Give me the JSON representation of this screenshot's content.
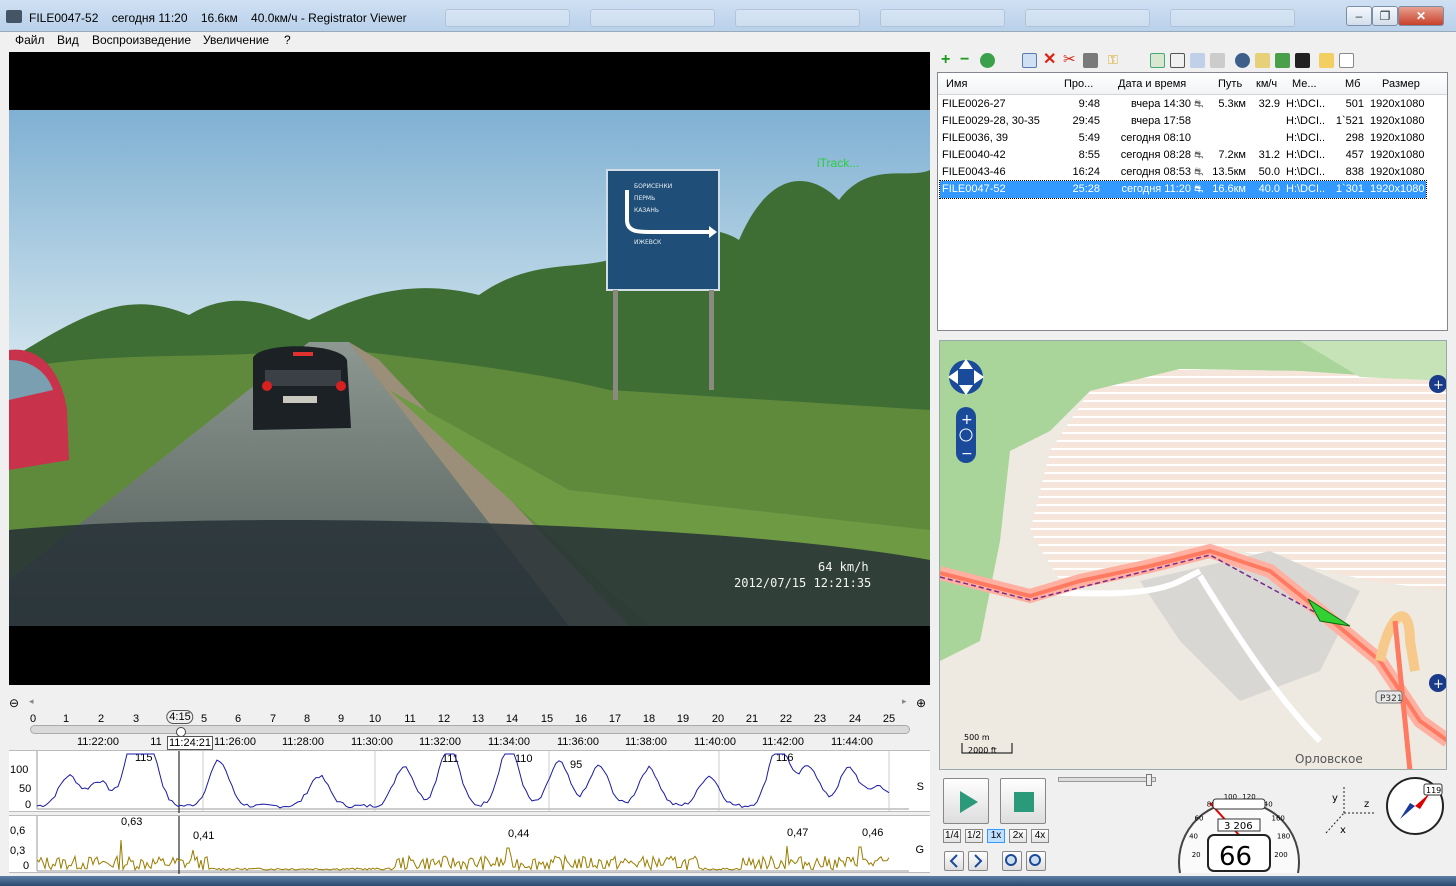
{
  "window": {
    "title": "FILE0047-52    сегодня 11:20    16.6км    40.0км/ч - Registrator Viewer",
    "buttons": [
      "–",
      "❐",
      "✕"
    ]
  },
  "menu": [
    "Файл",
    "Вид",
    "Воспроизведение",
    "Увеличение",
    "?"
  ],
  "video": {
    "brand": "iTrack...",
    "speed_overlay": "64 km/h",
    "datetime_overlay": "2012/07/15  12:21:35",
    "sign_lines": [
      "БОРИСЕНКИ",
      "ПЕРМЬ",
      "КАЗАНЬ",
      "ИЖЕВСК"
    ]
  },
  "timeline": {
    "minutes": [
      "0",
      "1",
      "2",
      "3",
      "4:15",
      "5",
      "6",
      "7",
      "8",
      "9",
      "10",
      "11",
      "12",
      "13",
      "14",
      "15",
      "16",
      "17",
      "18",
      "19",
      "20",
      "21",
      "22",
      "23",
      "24",
      "25"
    ],
    "clock": [
      "11:22:00",
      "11:24:21",
      "11:26:00",
      "11:28:00",
      "11:30:00",
      "11:32:00",
      "11:34:00",
      "11:36:00",
      "11:38:00",
      "11:40:00",
      "11:42:00",
      "11:44:00"
    ],
    "clock_partial": "11",
    "position_fraction": 0.17
  },
  "speed_graph": {
    "y_labels": [
      "100",
      "50",
      "0"
    ],
    "side_label": "S",
    "peaks": [
      "115",
      "111",
      "110",
      "95",
      "116"
    ]
  },
  "g_graph": {
    "y_labels": [
      "0,6",
      "0,3",
      "0"
    ],
    "side_label": "G",
    "peaks": [
      "0,63",
      "0,41",
      "0,44",
      "0,47",
      "0,46"
    ]
  },
  "filelist": {
    "columns": [
      "Имя",
      "Про...",
      "Дата и время",
      "Путь",
      "км/ч",
      "Ме...",
      "Мб",
      "Размер"
    ],
    "rows": [
      {
        "name": "FILE0026-27",
        "dur": "9:48",
        "date": "вчера 14:30",
        "path": "5.3км",
        "kmh": "32.9",
        "media": "H:\\DCI..",
        "mb": "501",
        "size": "1920x1080",
        "gps": true,
        "selected": false
      },
      {
        "name": "FILE0029-28, 30-35",
        "dur": "29:45",
        "date": "вчера 17:58",
        "path": "",
        "kmh": "",
        "media": "H:\\DCI..",
        "mb": "1`521",
        "size": "1920x1080",
        "gps": false,
        "selected": false
      },
      {
        "name": "FILE0036, 39",
        "dur": "5:49",
        "date": "сегодня 08:10",
        "path": "",
        "kmh": "",
        "media": "H:\\DCI..",
        "mb": "298",
        "size": "1920x1080",
        "gps": false,
        "selected": false
      },
      {
        "name": "FILE0040-42",
        "dur": "8:55",
        "date": "сегодня 08:28",
        "path": "7.2км",
        "kmh": "31.2",
        "media": "H:\\DCI..",
        "mb": "457",
        "size": "1920x1080",
        "gps": true,
        "selected": false
      },
      {
        "name": "FILE0043-46",
        "dur": "16:24",
        "date": "сегодня 08:53",
        "path": "13.5км",
        "kmh": "50.0",
        "media": "H:\\DCI..",
        "mb": "838",
        "size": "1920x1080",
        "gps": true,
        "selected": false
      },
      {
        "name": "FILE0047-52",
        "dur": "25:28",
        "date": "сегодня 11:20",
        "path": "16.6км",
        "kmh": "40.0",
        "media": "H:\\DCI..",
        "mb": "1`301",
        "size": "1920x1080",
        "gps": true,
        "selected": true
      }
    ]
  },
  "map": {
    "town": "Орловское",
    "road_label": "Р321",
    "scale_metric": "500 m",
    "scale_imperial": "2000 ft"
  },
  "controls": {
    "speed_rates": [
      "1/4",
      "1/2",
      "1x",
      "2x",
      "4x"
    ],
    "active_rate": "1x",
    "speed_value": "66",
    "odometer": "3 206",
    "dial_labels": [
      "20",
      "40",
      "60",
      "80",
      "100",
      "120",
      "140",
      "160",
      "180",
      "200"
    ],
    "axes": [
      "y",
      "z",
      "x"
    ],
    "compass_value": "119",
    "volume_fraction": 0.95
  },
  "colors": {
    "selection": "#3399ff",
    "route": "#ff8a70",
    "speed_line": "#1a1aa8",
    "g_line": "#9a7c00",
    "map_green": "#a9d49a"
  }
}
